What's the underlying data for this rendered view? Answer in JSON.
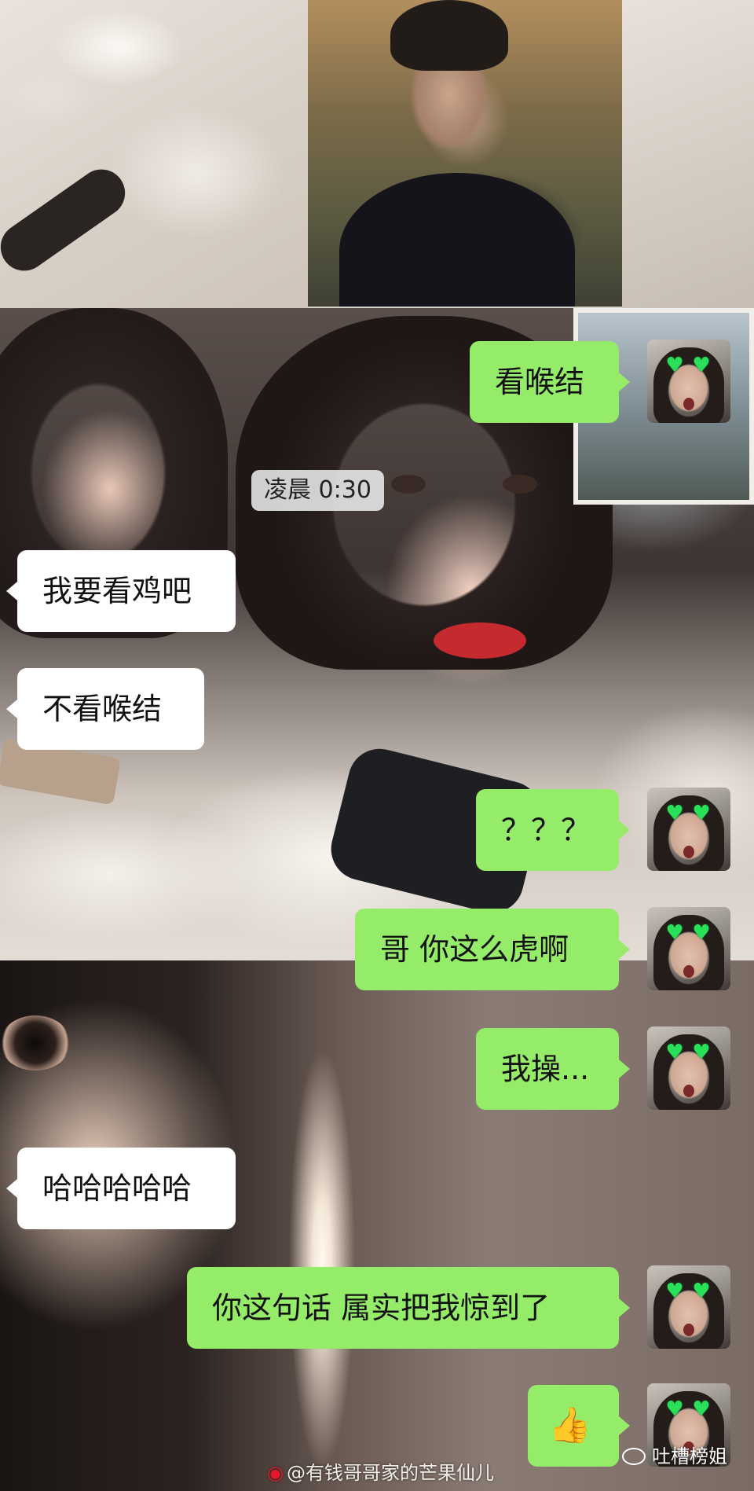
{
  "messages": [
    {
      "sender": "me",
      "text": "看喉结"
    },
    {
      "type": "timestamp",
      "text": "凌晨 0:30"
    },
    {
      "sender": "other",
      "text": "我要看鸡吧"
    },
    {
      "sender": "other",
      "text": "不看喉结"
    },
    {
      "sender": "me",
      "text": "？？？"
    },
    {
      "sender": "me",
      "text": "哥 你这么虎啊"
    },
    {
      "sender": "me",
      "text": "我操..."
    },
    {
      "sender": "other",
      "text": "哈哈哈哈哈"
    },
    {
      "sender": "me",
      "text": "你这句话 属实把我惊到了"
    },
    {
      "sender": "me",
      "emoji": "👍"
    }
  ],
  "watermarks": {
    "weibo": "@有钱哥哥家的芒果仙儿",
    "brand": "吐槽榜姐"
  },
  "colors": {
    "outgoing_bubble": "#95ec69",
    "incoming_bubble": "#ffffff"
  },
  "icons": {
    "avatar_sticker": "green-heart-eyes",
    "thumbs_up": "thumbs-up-emoji",
    "weibo": "weibo-logo",
    "wechat": "wechat-logo"
  }
}
